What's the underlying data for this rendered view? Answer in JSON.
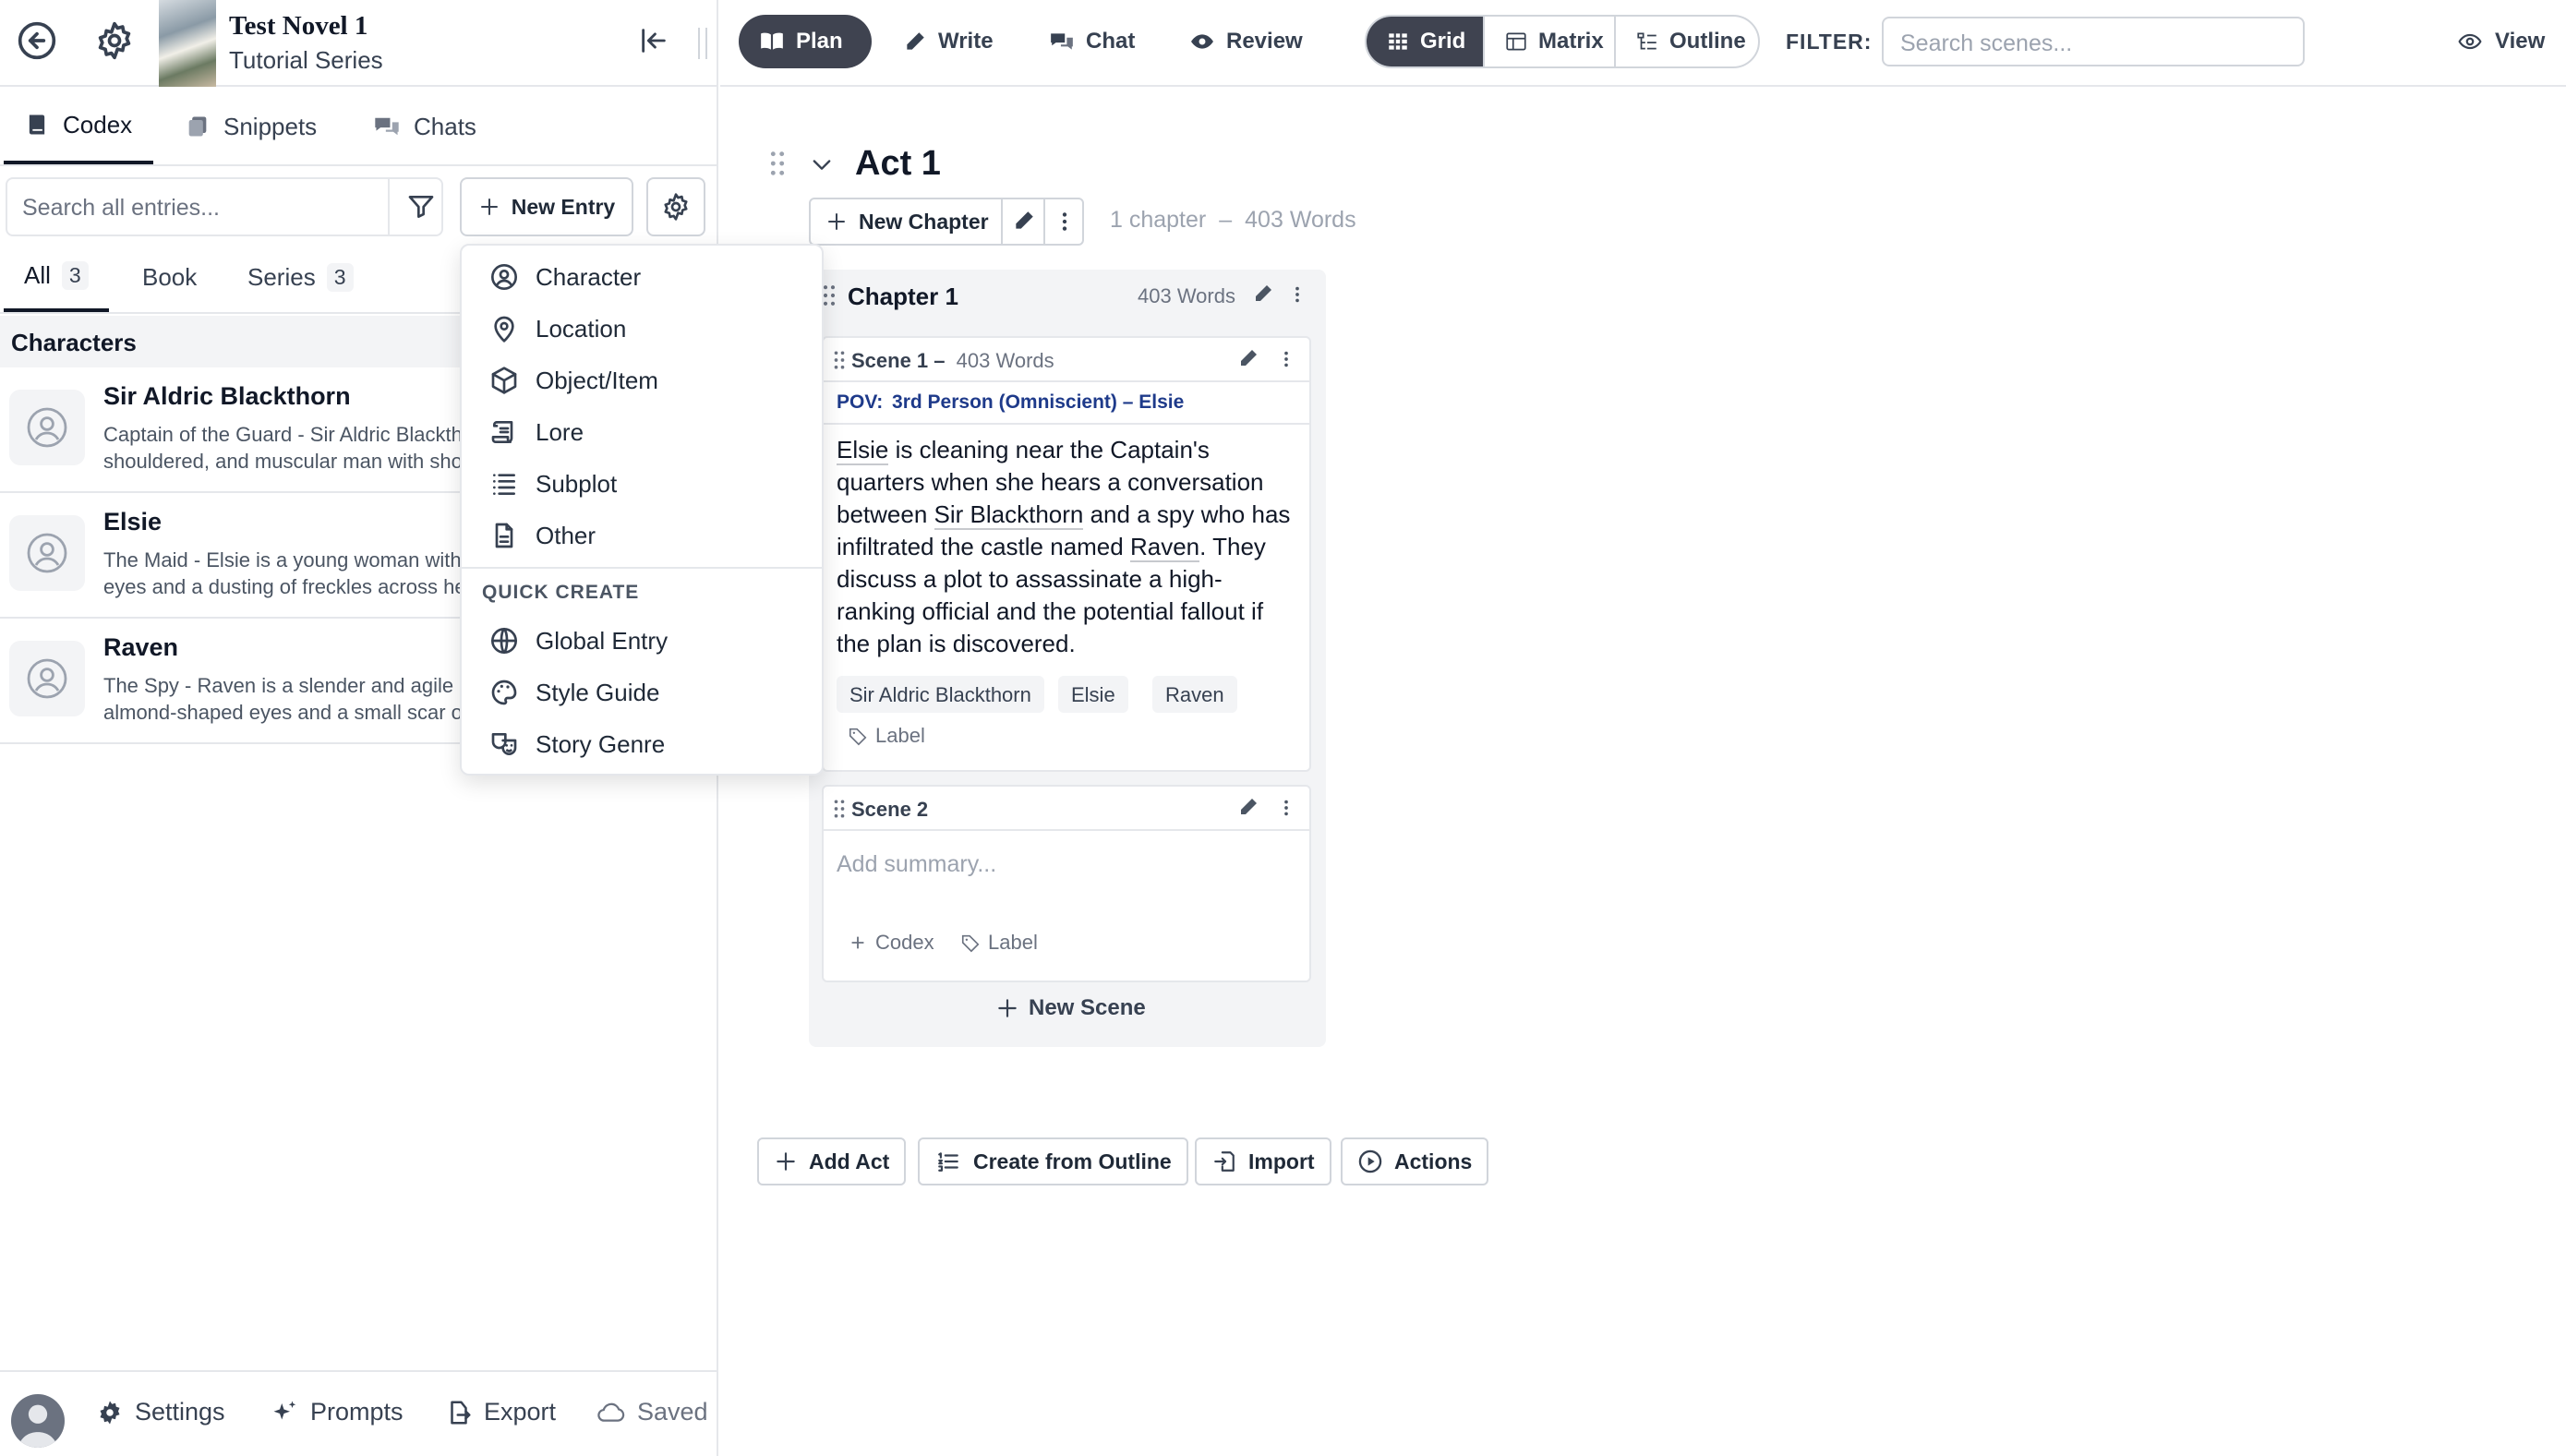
{
  "book": {
    "title": "Test Novel 1",
    "series": "Tutorial Series"
  },
  "left_tabs": [
    {
      "label": "Codex"
    },
    {
      "label": "Snippets"
    },
    {
      "label": "Chats"
    }
  ],
  "codex": {
    "search_placeholder": "Search all entries...",
    "new_entry_label": "New Entry",
    "filter_tabs": [
      {
        "label": "All",
        "count": "3"
      },
      {
        "label": "Book"
      },
      {
        "label": "Series",
        "count": "3"
      }
    ],
    "section_title": "Characters",
    "characters": [
      {
        "name": "Sir Aldric Blackthorn",
        "desc1": "Captain of the Guard - Sir Aldric Blackthorn",
        "desc2": "shouldered, and muscular man with short"
      },
      {
        "name": "Elsie",
        "desc1": "The Maid - Elsie is a young woman with",
        "desc2": "eyes and a dusting of freckles across her"
      },
      {
        "name": "Raven",
        "desc1": "The Spy - Raven is a slender and agile",
        "desc2": "almond-shaped eyes and a small scar on"
      }
    ]
  },
  "new_entry_menu": {
    "items": [
      {
        "label": "Character",
        "icon": "user-circle-icon"
      },
      {
        "label": "Location",
        "icon": "map-pin-icon"
      },
      {
        "label": "Object/Item",
        "icon": "cube-icon"
      },
      {
        "label": "Lore",
        "icon": "scroll-icon"
      },
      {
        "label": "Subplot",
        "icon": "list-icon"
      },
      {
        "label": "Other",
        "icon": "file-icon"
      }
    ],
    "quick_create_heading": "QUICK CREATE",
    "quick_items": [
      {
        "label": "Global Entry",
        "icon": "globe-icon"
      },
      {
        "label": "Style Guide",
        "icon": "palette-icon"
      },
      {
        "label": "Story Genre",
        "icon": "masks-icon"
      }
    ]
  },
  "bottom_bar": {
    "settings": "Settings",
    "prompts": "Prompts",
    "export": "Export",
    "saved": "Saved"
  },
  "topnav": {
    "modes": [
      {
        "label": "Plan"
      },
      {
        "label": "Write"
      },
      {
        "label": "Chat"
      },
      {
        "label": "Review"
      }
    ],
    "views": [
      {
        "label": "Grid"
      },
      {
        "label": "Matrix"
      },
      {
        "label": "Outline"
      }
    ],
    "filter_label": "FILTER:",
    "filter_placeholder": "Search scenes...",
    "view_label": "View"
  },
  "act": {
    "title": "Act 1",
    "new_chapter_label": "New Chapter",
    "stats_chapters": "1 chapter",
    "stats_sep": "–",
    "stats_words": "403 Words"
  },
  "chapter": {
    "title": "Chapter 1",
    "words": "403 Words",
    "new_scene_label": "New Scene"
  },
  "scene1": {
    "label": "Scene 1",
    "dash": "–",
    "words": "403 Words",
    "pov_label": "POV:",
    "pov_value": "3rd Person (Omniscient) – Elsie",
    "summary": {
      "e1": "Elsie",
      "t1": " is cleaning near the Captain's quarters when she hears a conversation between ",
      "e2": "Sir Blackthorn",
      "t2": " and a spy who has infiltrated the castle named ",
      "e3": "Raven",
      "t3": ". They discuss a plot to assassinate a high-ranking official and the potential fallout if the plan is discovered."
    },
    "tags": [
      "Sir Aldric Blackthorn",
      "Elsie",
      "Raven"
    ],
    "label_link": "Label"
  },
  "scene2": {
    "label": "Scene 2",
    "summary_placeholder": "Add summary...",
    "codex_link": "Codex",
    "label_link": "Label"
  },
  "bottom_actions": {
    "add_act": "Add Act",
    "create_from_outline": "Create from Outline",
    "import": "Import",
    "actions": "Actions"
  }
}
